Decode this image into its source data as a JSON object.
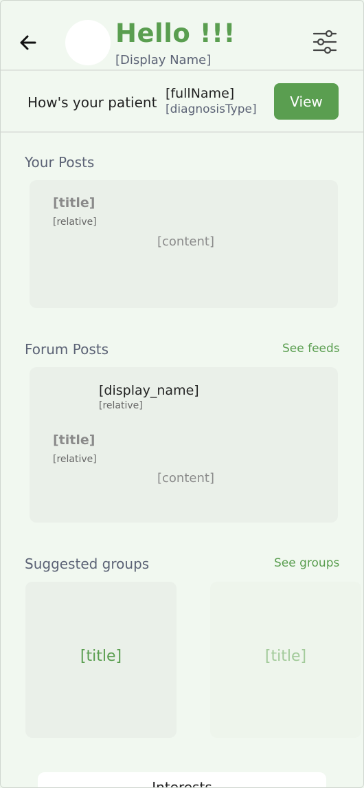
{
  "header": {
    "greeting": "Hello !!!",
    "display_name": "[Display Name]"
  },
  "patient": {
    "question": "How's your patient",
    "full_name": "[fullName]",
    "diagnosis_type": "[diagnosisType]",
    "view_label": "View"
  },
  "your_posts": {
    "title": "Your Posts",
    "card": {
      "title": "[title]",
      "relative": "[relative]",
      "content": "[content]"
    }
  },
  "forum_posts": {
    "title": "Forum Posts",
    "see_feeds": "See feeds",
    "card": {
      "display_name": "[display_name]",
      "author_relative": "[relative]",
      "title": "[title]",
      "relative": "[relative]",
      "content": "[content]"
    }
  },
  "suggested_groups": {
    "title": "Suggested groups",
    "see_groups": "See groups",
    "items": [
      {
        "title": "[title]"
      },
      {
        "title": "[title]"
      }
    ]
  },
  "interests": {
    "title": "Interests"
  },
  "colors": {
    "accent": "#5a9e50",
    "background": "#f1f8f0",
    "card": "#eaf0e9"
  }
}
